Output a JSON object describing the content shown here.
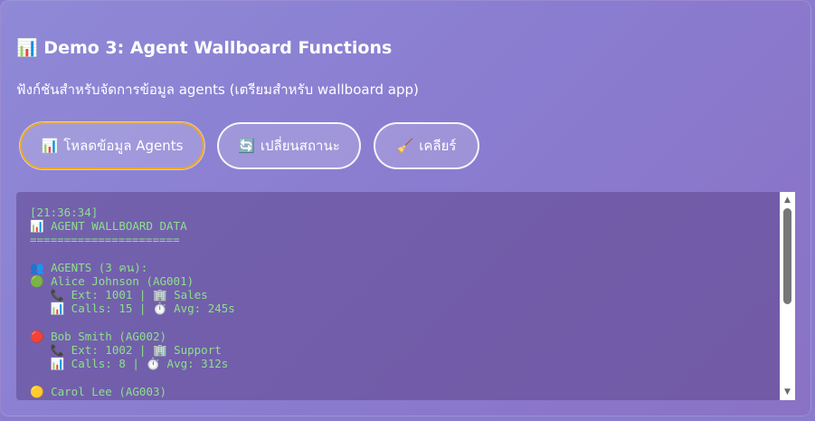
{
  "header": {
    "title_icon": "📊",
    "title": "Demo 3: Agent Wallboard Functions",
    "subtitle": "ฟังก์ชันสำหรับจัดการข้อมูล agents (เตรียมสำหรับ wallboard app)"
  },
  "buttons": [
    {
      "icon": "📊",
      "icon_name": "chart-icon",
      "label": "โหลดข้อมูล Agents"
    },
    {
      "icon": "🔄",
      "icon_name": "refresh-icon",
      "label": "เปลี่ยนสถานะ"
    },
    {
      "icon": "🧹",
      "icon_name": "broom-icon",
      "label": "เคลียร์"
    }
  ],
  "console": {
    "lines": [
      "[21:36:34]",
      "📊 AGENT WALLBOARD DATA",
      "======================",
      "",
      "👥 AGENTS (3 คน):",
      "🟢 Alice Johnson (AG001)",
      "   📞 Ext: 1001 | 🏢 Sales",
      "   📊 Calls: 15 | ⏱️ Avg: 245s",
      "",
      "🔴 Bob Smith (AG002)",
      "   📞 Ext: 1002 | 🏢 Support",
      "   📊 Calls: 8 | ⏱️ Avg: 312s",
      "",
      "🟡 Carol Lee (AG003)"
    ]
  },
  "scrollbar": {
    "up_arrow": "▲",
    "down_arrow": "▼"
  },
  "colors": {
    "console_text": "#8de08b",
    "focus_border": "#f0a81c"
  }
}
